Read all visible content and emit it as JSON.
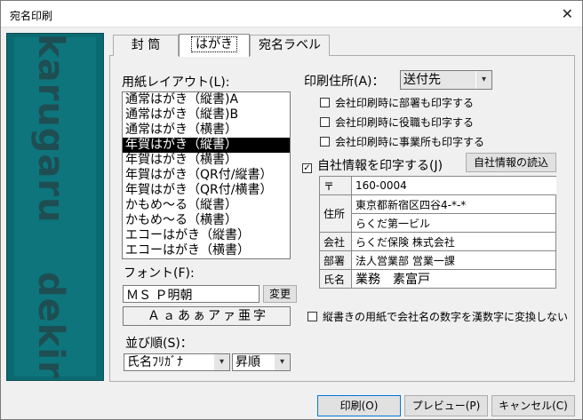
{
  "window": {
    "title": "宛名印刷",
    "close": "✕"
  },
  "side": {
    "word_top": "karugaru",
    "word_bottom": "dekiru"
  },
  "tabs": [
    "封 筒",
    "はがき",
    "宛名ラベル"
  ],
  "layout": {
    "label": "用紙レイアウト(L):",
    "items": [
      "通常はがき（縦書)A",
      "通常はがき（縦書)B",
      "通常はがき（横書）",
      "年賀はがき（縦書）",
      "年賀はがき（横書）",
      "年賀はがき（QR付/縦書）",
      "年賀はがき（QR付/横書）",
      "かもめ～る（縦書）",
      "かもめ～る（横書）",
      "エコーはがき（縦書）",
      "エコーはがき（横書）"
    ],
    "selected_index": 3
  },
  "font": {
    "label": "フォント(F):",
    "value": "ＭＳ Ｐ明朝",
    "change_button": "変更",
    "preview": "Ａａあぁアァ亜字"
  },
  "sort": {
    "label": "並び順(S)：",
    "field": "氏名ﾌﾘｶﾞﾅ",
    "order": "昇順"
  },
  "print_addr": {
    "label": "印刷住所(A)：",
    "value": "送付先"
  },
  "options": [
    {
      "label": "会社印刷時に部署も印字する",
      "checked": false
    },
    {
      "label": "会社印刷時に役職も印字する",
      "checked": false
    },
    {
      "label": "会社印刷時に事業所も印字する",
      "checked": false
    }
  ],
  "own_info": {
    "label": "自社情報を印字する(J)",
    "checked": true,
    "read_button": "自社情報の読込"
  },
  "info": {
    "postal_h": "〒",
    "postal": "160-0004",
    "addr_h": "住所",
    "addr1": "東京都新宿区四谷4-*-*",
    "addr2": "らくだ第一ビル",
    "company_h": "会社",
    "company": "らくだ保険 株式会社",
    "dept_h": "部署",
    "dept": "法人営業部 営業一課",
    "name_h": "氏名",
    "name": "業務　素富戸"
  },
  "kanji_option": {
    "label": "縦書きの用紙で会社名の数字を漢数字に変換しない",
    "checked": false
  },
  "footer": {
    "print": "印刷(O)",
    "preview": "プレビュー(P)",
    "cancel": "キャンセル(C)"
  }
}
